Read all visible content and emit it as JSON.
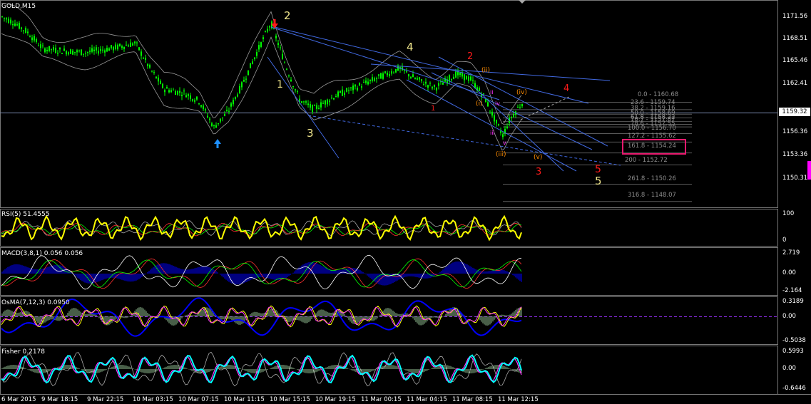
{
  "chart_title": "GOLD,M15",
  "price_scale": [
    "1171.56",
    "1168.51",
    "1165.46",
    "1162.41",
    "1159.32",
    "1156.36",
    "1153.36",
    "1150.31"
  ],
  "current_price": "1159.32",
  "time_labels": [
    "6 Mar 2015",
    "9 Mar 18:15",
    "9 Mar 22:15",
    "10 Mar 03:15",
    "10 Mar 07:15",
    "10 Mar 11:15",
    "10 Mar 15:15",
    "10 Mar 19:15",
    "11 Mar 00:15",
    "11 Mar 04:15",
    "11 Mar 08:15",
    "11 Mar 12:15"
  ],
  "fibonacci_levels": [
    {
      "label": "0.0 - 1160.68",
      "price": 1160.68
    },
    {
      "label": "23.6 - 1159.74",
      "price": 1159.74
    },
    {
      "label": "38.2 - 1159.16",
      "price": 1159.16
    },
    {
      "label": "50.0 - 1158.69",
      "price": 1158.69
    },
    {
      "label": "61.8 - 1158.22",
      "price": 1158.22
    },
    {
      "label": "70.7 - 1157.87",
      "price": 1157.87
    },
    {
      "label": "78.6 - 1157.55",
      "price": 1157.55
    },
    {
      "label": "100.0 - 1156.70",
      "price": 1156.7
    },
    {
      "label": "127.2 - 1155.62",
      "price": 1155.62
    },
    {
      "label": "161.8 - 1154.24",
      "price": 1154.24
    },
    {
      "label": "200 - 1152.72",
      "price": 1152.72
    },
    {
      "label": "261.8 - 1150.26",
      "price": 1150.26
    },
    {
      "label": "316.8 - 1148.07",
      "price": 1148.07
    }
  ],
  "highlighted_level": "161.8 - 1154.24",
  "wave_labels": {
    "yellow_2": "2",
    "yellow_1": "1",
    "yellow_3": "3",
    "yellow_4": "4",
    "yellow_5": "5",
    "red_1": "1",
    "red_2": "2",
    "red_3": "3",
    "red_4": "4",
    "red_5": "5",
    "orange_i": "(i)",
    "orange_ii": "(ii)",
    "orange_iii": "(iii)",
    "orange_iv": "(iv)",
    "orange_v": "(v)",
    "mag_ii": "ii",
    "mag_iii": "iii",
    "mag_iv": "iv",
    "mag_v": "v"
  },
  "indicators": {
    "rsi": {
      "label": "RSI(5) 51.4555",
      "scale": [
        "100",
        "0"
      ]
    },
    "macd": {
      "label": "MACD(3,8,1) 0.056 0.056",
      "scale": [
        "2.719",
        "0.00",
        "-2.164"
      ]
    },
    "osma": {
      "label": "OsMA(7,12,3) 0.0950",
      "scale": [
        "0.3189",
        "0.00",
        "-0.5038"
      ]
    },
    "fisher": {
      "label": "Fisher 0.2178",
      "scale": [
        "0.5993",
        "0.00",
        "-0.6446"
      ]
    }
  },
  "colors": {
    "background": "#000000",
    "candle_up": "#00ff00",
    "grid_separator": "#777777",
    "rsi_line": "#ffff00",
    "macd_hist": "#0000ff",
    "fisher_line": "#00ffff",
    "highlight": "#e8196e",
    "wave_yellow": "#f0e68c",
    "wave_red": "#ff1a1a",
    "wave_orange": "#ff8c00",
    "wave_magenta": "#ff33ff",
    "trendline": "#4169e1",
    "arrow_up": "#1e90ff",
    "arrow_down": "#ff1a1a"
  },
  "markers": {
    "arrow_up": "buy-arrow",
    "arrow_down": "sell-arrow"
  },
  "chart_data": {
    "type": "line",
    "title": "GOLD,M15",
    "x": [
      "6 Mar 2015",
      "9 Mar 18:15",
      "9 Mar 22:15",
      "10 Mar 03:15",
      "10 Mar 07:15",
      "10 Mar 11:15",
      "10 Mar 15:15",
      "10 Mar 19:15",
      "11 Mar 00:15",
      "11 Mar 04:15",
      "11 Mar 08:15",
      "11 Mar 12:15"
    ],
    "series": [
      {
        "values": [
          1171.6,
          1167.5,
          1167.3,
          1167.4,
          1160.8,
          1157.5,
          1161.5,
          1170.8,
          1159.8,
          1161.6,
          1163.0,
          1165.0,
          1164.0,
          1162.5,
          1164.0,
          1162.5,
          1157.5,
          1159.8
        ]
      }
    ],
    "ylim": [
      1147.5,
      1173.5
    ]
  }
}
